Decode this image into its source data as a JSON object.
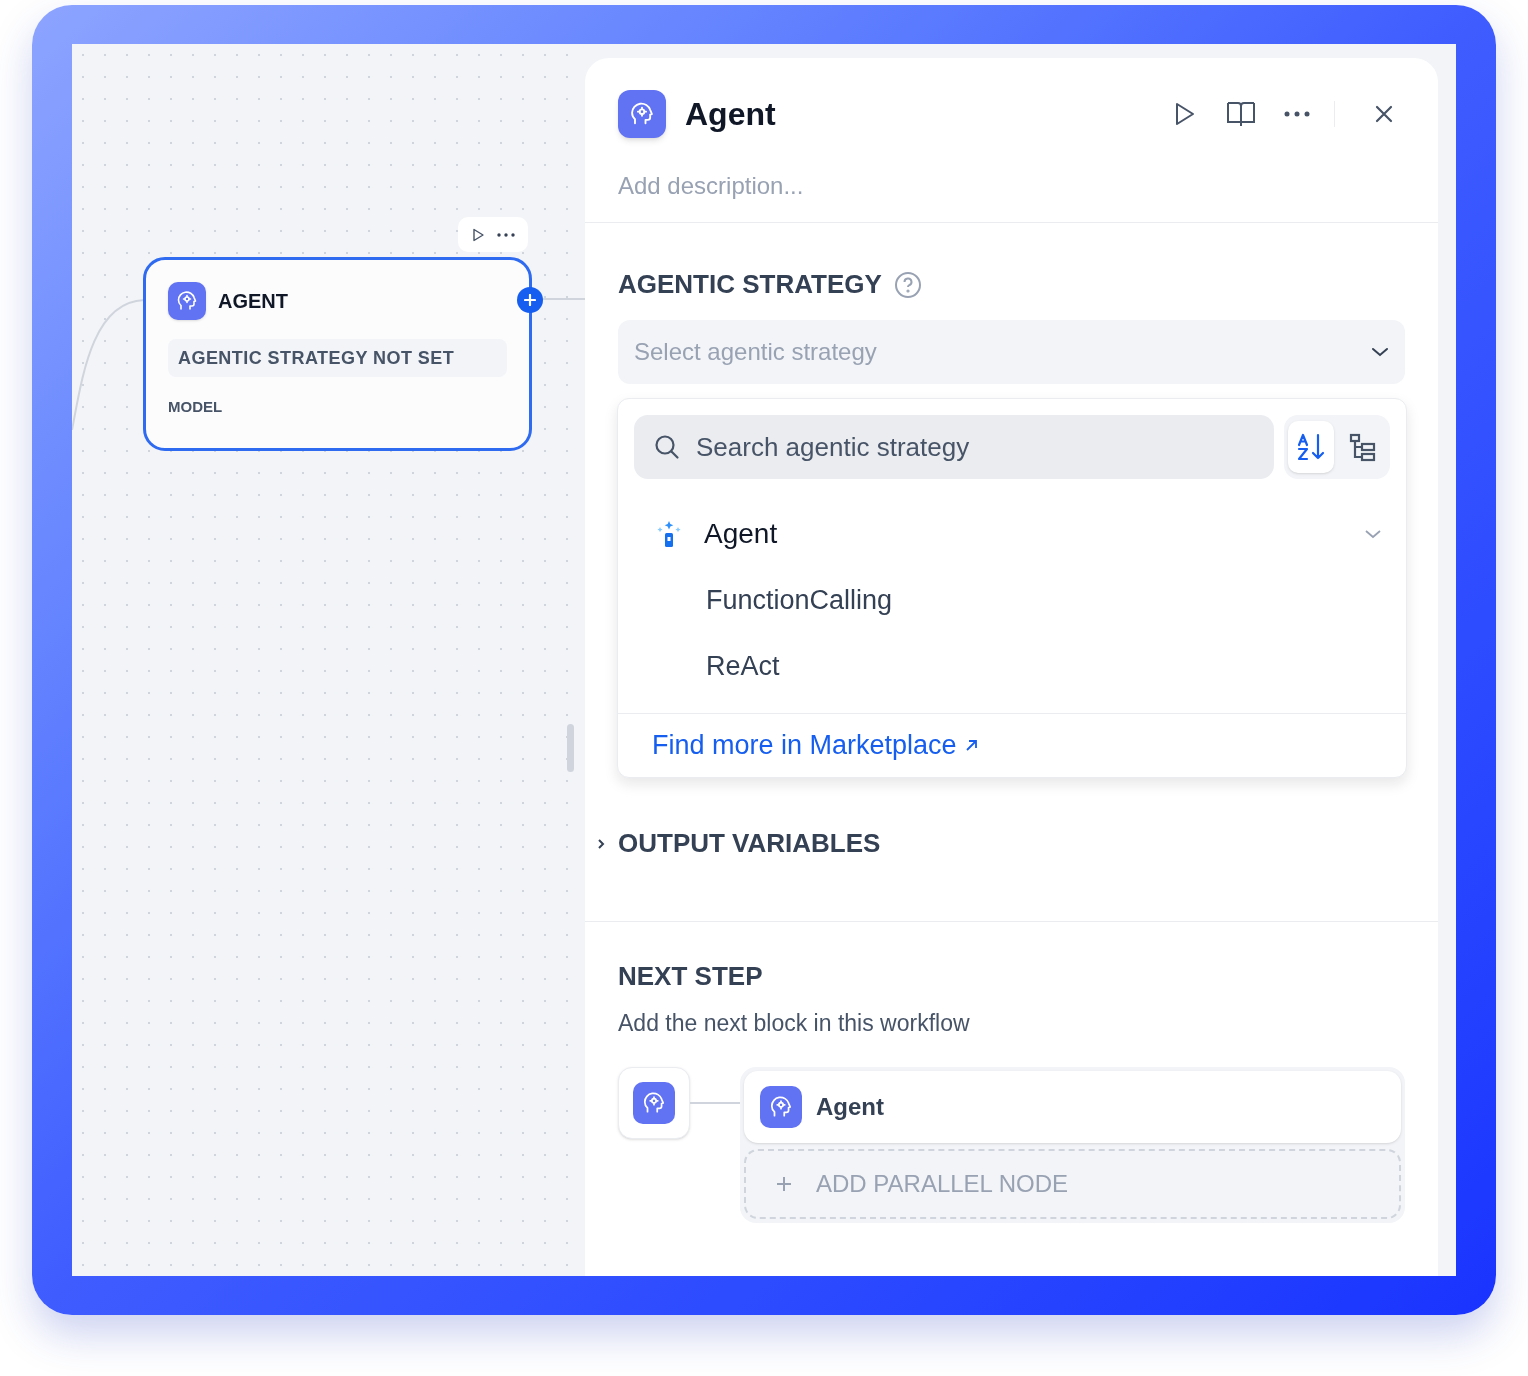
{
  "canvas": {
    "node": {
      "title": "AGENT",
      "status": "AGENTIC STRATEGY NOT SET",
      "field": "MODEL",
      "selected": true
    }
  },
  "panel": {
    "title": "Agent",
    "description_placeholder": "Add description...",
    "strategy": {
      "label": "AGENTIC STRATEGY",
      "select_placeholder": "Select agentic strategy",
      "dropdown": {
        "search_placeholder": "Search agentic strategy",
        "views": [
          {
            "kind": "alphabetical",
            "selected": true
          },
          {
            "kind": "tree",
            "selected": false
          }
        ],
        "providers": [
          {
            "name": "Agent",
            "expanded": true,
            "children": [
              {
                "name": "FunctionCalling"
              },
              {
                "name": "ReAct"
              }
            ]
          }
        ],
        "footer_link": "Find more in Marketplace"
      }
    },
    "output_variables": {
      "label": "OUTPUT VARIABLES",
      "expanded": false
    },
    "next_step": {
      "label": "NEXT STEP",
      "description": "Add the next block in this workflow",
      "nodes": [
        {
          "title": "Agent"
        }
      ],
      "add_label": "ADD PARALLEL NODE"
    }
  }
}
